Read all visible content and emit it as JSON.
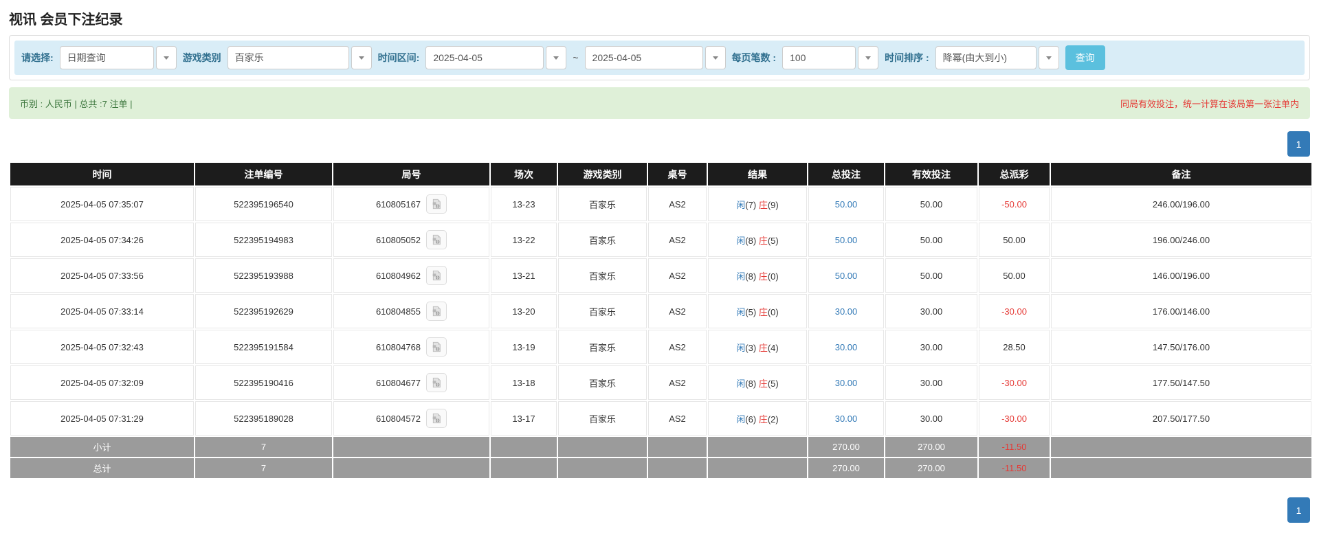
{
  "page": {
    "title": "视讯 会员下注纪录"
  },
  "filters": {
    "query_type": {
      "label": "请选择:",
      "value": "日期查询"
    },
    "game_category": {
      "label": "游戏类别",
      "value": "百家乐"
    },
    "time_range": {
      "label": "时间区间:",
      "from": "2025-04-05",
      "to": "2025-04-05",
      "separator": "~"
    },
    "page_size": {
      "label": "每页笔数 :",
      "value": "100"
    },
    "time_sort": {
      "label": "时间排序 :",
      "value": "降幂(由大到小)"
    },
    "search_button_label": "查询"
  },
  "summary": {
    "left": "币别 : 人民币 | 总共 :7 注单 |",
    "right": "同局有效投注，统一计算在该局第一张注单内"
  },
  "pagination": {
    "page": "1"
  },
  "icons": {
    "dropdown": "chevron-down-icon",
    "round_video": "video-record-icon"
  },
  "colors": {
    "filter_bg": "#d9edf7",
    "filter_label": "#31708f",
    "search_button": "#5bc0de",
    "summary_bg": "#dff0d8",
    "summary_text": "#3c763d",
    "warning_red": "#e53935",
    "header_bg": "#1c1c1c",
    "footer_gray": "#9b9b9b",
    "link_blue": "#337ab7",
    "player_blue": "#337ab7",
    "banker_red": "#e53935",
    "pagination_blue": "#337ab7"
  },
  "table": {
    "columns": [
      "时间",
      "注单编号",
      "局号",
      "场次",
      "游戏类别",
      "桌号",
      "结果",
      "总投注",
      "有效投注",
      "总派彩",
      "备注"
    ],
    "rows": [
      {
        "time": "2025-04-05 07:35:07",
        "bet_id": "522395196540",
        "round_id": "610805167",
        "session": "13-23",
        "game": "百家乐",
        "table_no": "AS2",
        "result_player": "闲",
        "result_player_num": "(7)",
        "result_banker": "庄",
        "result_banker_num": "(9)",
        "total_bet": "50.00",
        "valid_bet": "50.00",
        "payout": "-50.00",
        "remark": "246.00/196.00"
      },
      {
        "time": "2025-04-05 07:34:26",
        "bet_id": "522395194983",
        "round_id": "610805052",
        "session": "13-22",
        "game": "百家乐",
        "table_no": "AS2",
        "result_player": "闲",
        "result_player_num": "(8)",
        "result_banker": "庄",
        "result_banker_num": "(5)",
        "total_bet": "50.00",
        "valid_bet": "50.00",
        "payout": "50.00",
        "remark": "196.00/246.00"
      },
      {
        "time": "2025-04-05 07:33:56",
        "bet_id": "522395193988",
        "round_id": "610804962",
        "session": "13-21",
        "game": "百家乐",
        "table_no": "AS2",
        "result_player": "闲",
        "result_player_num": "(8)",
        "result_banker": "庄",
        "result_banker_num": "(0)",
        "total_bet": "50.00",
        "valid_bet": "50.00",
        "payout": "50.00",
        "remark": "146.00/196.00"
      },
      {
        "time": "2025-04-05 07:33:14",
        "bet_id": "522395192629",
        "round_id": "610804855",
        "session": "13-20",
        "game": "百家乐",
        "table_no": "AS2",
        "result_player": "闲",
        "result_player_num": "(5)",
        "result_banker": "庄",
        "result_banker_num": "(0)",
        "total_bet": "30.00",
        "valid_bet": "30.00",
        "payout": "-30.00",
        "remark": "176.00/146.00"
      },
      {
        "time": "2025-04-05 07:32:43",
        "bet_id": "522395191584",
        "round_id": "610804768",
        "session": "13-19",
        "game": "百家乐",
        "table_no": "AS2",
        "result_player": "闲",
        "result_player_num": "(3)",
        "result_banker": "庄",
        "result_banker_num": "(4)",
        "total_bet": "30.00",
        "valid_bet": "30.00",
        "payout": "28.50",
        "remark": "147.50/176.00"
      },
      {
        "time": "2025-04-05 07:32:09",
        "bet_id": "522395190416",
        "round_id": "610804677",
        "session": "13-18",
        "game": "百家乐",
        "table_no": "AS2",
        "result_player": "闲",
        "result_player_num": "(8)",
        "result_banker": "庄",
        "result_banker_num": "(5)",
        "total_bet": "30.00",
        "valid_bet": "30.00",
        "payout": "-30.00",
        "remark": "177.50/147.50"
      },
      {
        "time": "2025-04-05 07:31:29",
        "bet_id": "522395189028",
        "round_id": "610804572",
        "session": "13-17",
        "game": "百家乐",
        "table_no": "AS2",
        "result_player": "闲",
        "result_player_num": "(6)",
        "result_banker": "庄",
        "result_banker_num": "(2)",
        "total_bet": "30.00",
        "valid_bet": "30.00",
        "payout": "-30.00",
        "remark": "207.50/177.50"
      }
    ],
    "subtotal": {
      "label": "小计",
      "count": "7",
      "total_bet": "270.00",
      "valid_bet": "270.00",
      "payout": "-11.50"
    },
    "total": {
      "label": "总计",
      "count": "7",
      "total_bet": "270.00",
      "valid_bet": "270.00",
      "payout": "-11.50"
    }
  }
}
